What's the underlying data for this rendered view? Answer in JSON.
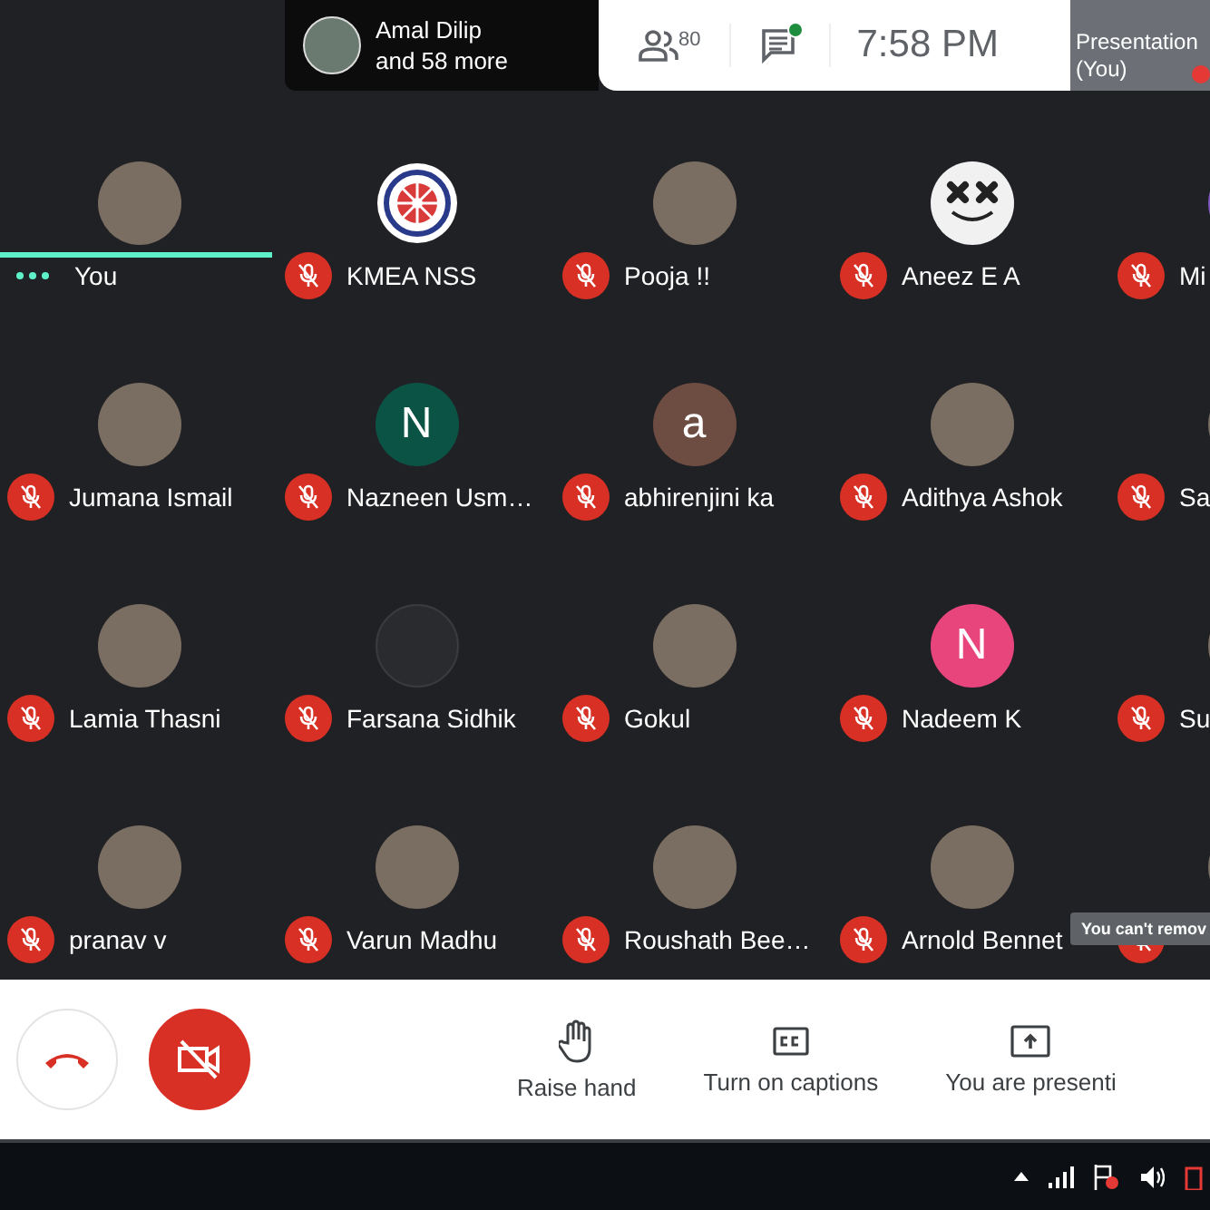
{
  "top_bar": {
    "presenter": {
      "name": "Amal Dilip",
      "more": "and 58 more"
    },
    "participants_count": "80",
    "chat_unread": true,
    "time": "7:58 PM",
    "presentation": {
      "label": "Presentation",
      "sublabel": "(You)",
      "muted": true
    }
  },
  "participants": [
    {
      "name": "You",
      "kind": "photo",
      "speaking": true
    },
    {
      "name": "KMEA NSS",
      "kind": "logo",
      "speaking": false
    },
    {
      "name": "Pooja !!",
      "kind": "photo",
      "speaking": false
    },
    {
      "name": "Aneez E A",
      "kind": "mask",
      "speaking": false
    },
    {
      "name": "Mi",
      "kind": "initial",
      "color": "#7e57c2",
      "speaking": false
    },
    {
      "name": "Jumana Ismail",
      "kind": "photo",
      "speaking": false
    },
    {
      "name": "Nazneen Usm…",
      "kind": "initial",
      "initial": "N",
      "color": "#0b5345",
      "speaking": false
    },
    {
      "name": "abhirenjini ka",
      "kind": "initial",
      "initial": "a",
      "color": "#6d4c41",
      "speaking": false
    },
    {
      "name": "Adithya Ashok",
      "kind": "photo",
      "speaking": false
    },
    {
      "name": "Sa",
      "kind": "photo",
      "speaking": false
    },
    {
      "name": "Lamia Thasni",
      "kind": "photo",
      "speaking": false
    },
    {
      "name": "Farsana Sidhik",
      "kind": "blank",
      "speaking": false
    },
    {
      "name": "Gokul",
      "kind": "photo",
      "speaking": false
    },
    {
      "name": "Nadeem K",
      "kind": "initial",
      "initial": "N",
      "color": "#e8457c",
      "speaking": false
    },
    {
      "name": "Su",
      "kind": "photo",
      "speaking": false
    },
    {
      "name": "pranav v",
      "kind": "photo",
      "speaking": false
    },
    {
      "name": "Varun Madhu",
      "kind": "photo",
      "speaking": false
    },
    {
      "name": "Roushath Bee…",
      "kind": "photo",
      "speaking": false
    },
    {
      "name": "Arnold Bennet",
      "kind": "photo",
      "speaking": false
    },
    {
      "kind": "photo",
      "speaking": false
    }
  ],
  "tooltip": "You can't remov",
  "controls": [
    {
      "kind": "hangup"
    },
    {
      "kind": "camera",
      "on": false
    }
  ],
  "actions": [
    {
      "kind": "hand",
      "label": "Raise hand"
    },
    {
      "kind": "captions",
      "label": "Turn on captions"
    },
    {
      "kind": "present",
      "label": "You are presenti"
    }
  ]
}
